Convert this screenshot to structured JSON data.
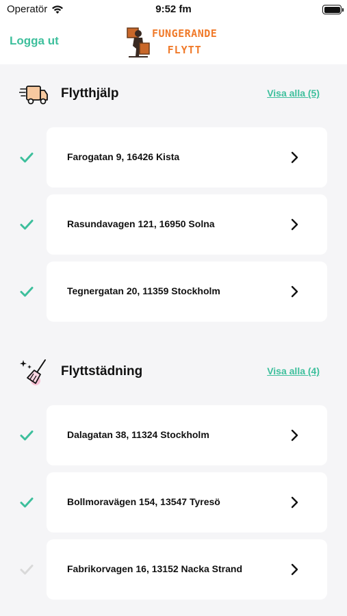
{
  "status_bar": {
    "carrier": "Operatör",
    "time": "9:52 fm"
  },
  "nav": {
    "logout_label": "Logga ut",
    "logo_line1": "FUNGERANDE",
    "logo_line2": "FLYTT"
  },
  "colors": {
    "accent": "#3dbf9c",
    "logo": "#f07a2a",
    "pending_check": "#d9d9d9"
  },
  "sections": [
    {
      "title": "Flytthjälp",
      "icon": "moving-truck-icon",
      "see_all": "Visa alla (5)",
      "items": [
        {
          "address": "Farogatan 9, 16426 Kista",
          "completed": true
        },
        {
          "address": "Rasundavagen 121, 16950 Solna",
          "completed": true
        },
        {
          "address": "Tegnergatan 20, 11359 Stockholm",
          "completed": true
        }
      ]
    },
    {
      "title": "Flyttstädning",
      "icon": "broom-icon",
      "see_all": "Visa alla (4)",
      "items": [
        {
          "address": "Dalagatan 38, 11324 Stockholm",
          "completed": true
        },
        {
          "address": "Bollmoravägen 154, 13547 Tyresö",
          "completed": true
        },
        {
          "address": "Fabrikorvagen 16, 13152 Nacka Strand",
          "completed": false
        }
      ]
    }
  ]
}
